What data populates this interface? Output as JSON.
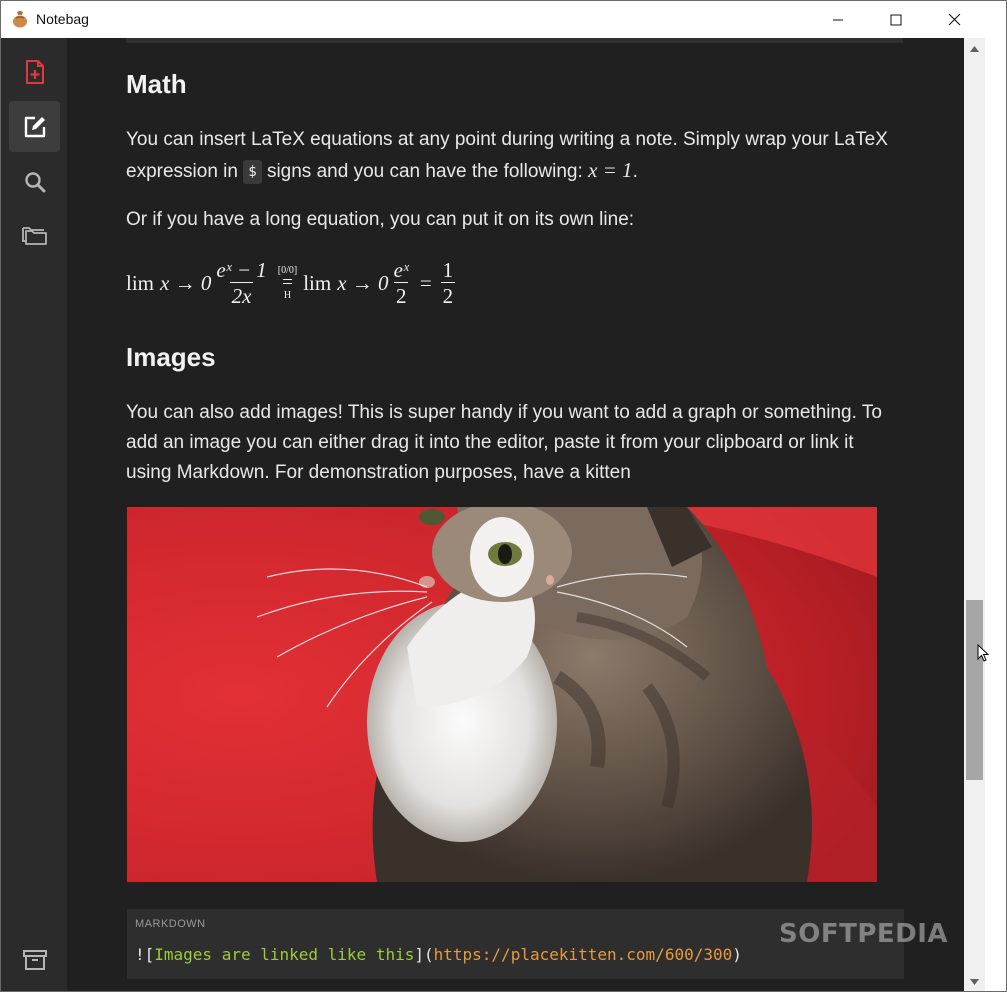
{
  "window": {
    "title": "Notebag",
    "controls": [
      "minimize",
      "maximize",
      "close"
    ]
  },
  "sidebar": {
    "items": [
      {
        "name": "new-note",
        "icon": "file-plus-icon",
        "color": "#e03a3a"
      },
      {
        "name": "edit-note",
        "icon": "edit-icon",
        "active": true
      },
      {
        "name": "search",
        "icon": "search-icon"
      },
      {
        "name": "notebooks",
        "icon": "folders-icon"
      }
    ],
    "bottom_item": {
      "name": "archive",
      "icon": "archive-icon"
    }
  },
  "content": {
    "math": {
      "heading": "Math",
      "para1_part1": "You can insert LaTeX equations at any point during writing a note. Simply wrap your LaTeX expression in",
      "para1_code": "$",
      "para1_part2": "signs and you can have the following:",
      "para1_math": "x = 1",
      "para1_end": ".",
      "para2": "Or if you have a long equation, you can put it on its own line:",
      "equation": {
        "lim1": "lim",
        "expr1": "x → 0",
        "frac1_num": "eˣ − 1",
        "frac1_den": "2x",
        "lhop_top": "[0/0]",
        "lhop_mid": "=",
        "lhop_bottom": "H",
        "lim2": "lim",
        "expr2": "x → 0",
        "frac2_num": "eˣ",
        "frac2_den": "2",
        "eq": "=",
        "frac3_num": "1",
        "frac3_den": "2"
      }
    },
    "images": {
      "heading": "Images",
      "para": "You can also add images! This is super handy if you want to add a graph or something. To add an image you can either drag it into the editor, paste it from your clipboard or link it using Markdown. For demonstration purposes, have a kitten"
    },
    "code": {
      "language": "MARKDOWN",
      "prefix": "![",
      "alt": "Images are linked like this",
      "middle": "](",
      "url": "https://placekitten.com/600/300",
      "suffix": ")"
    }
  },
  "watermark": "SOFTPEDIA",
  "colors": {
    "background": "#202020",
    "sidebar": "#2b2b2b",
    "accent_red": "#e03a3a",
    "code_alt": "#9ccc3a",
    "code_url": "#e79a3c"
  }
}
